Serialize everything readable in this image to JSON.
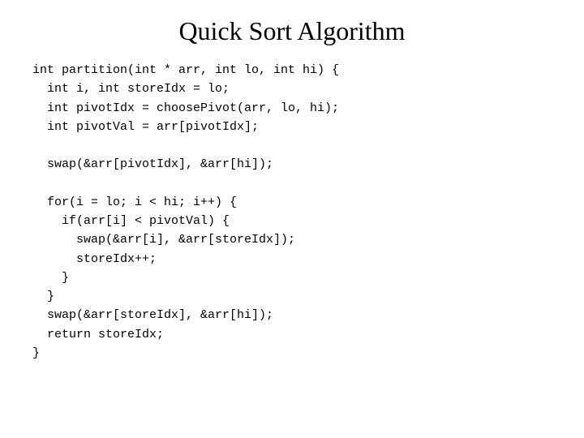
{
  "page": {
    "title": "Quick Sort Algorithm",
    "background": "#ffffff"
  },
  "code": {
    "lines": [
      "int partition(int * arr, int lo, int hi) {",
      "  int i, int storeIdx = lo;",
      "  int pivotIdx = choosePivot(arr, lo, hi);",
      "  int pivotVal = arr[pivotIdx];",
      "",
      "  swap(&arr[pivotIdx], &arr[hi]);",
      "",
      "  for(i = lo; i < hi; i++) {",
      "    if(arr[i] < pivotVal) {",
      "      swap(&arr[i], &arr[storeIdx]);",
      "      storeIdx++;",
      "    }",
      "  }",
      "  swap(&arr[storeIdx], &arr[hi]);",
      "  return storeIdx;",
      "}"
    ]
  }
}
